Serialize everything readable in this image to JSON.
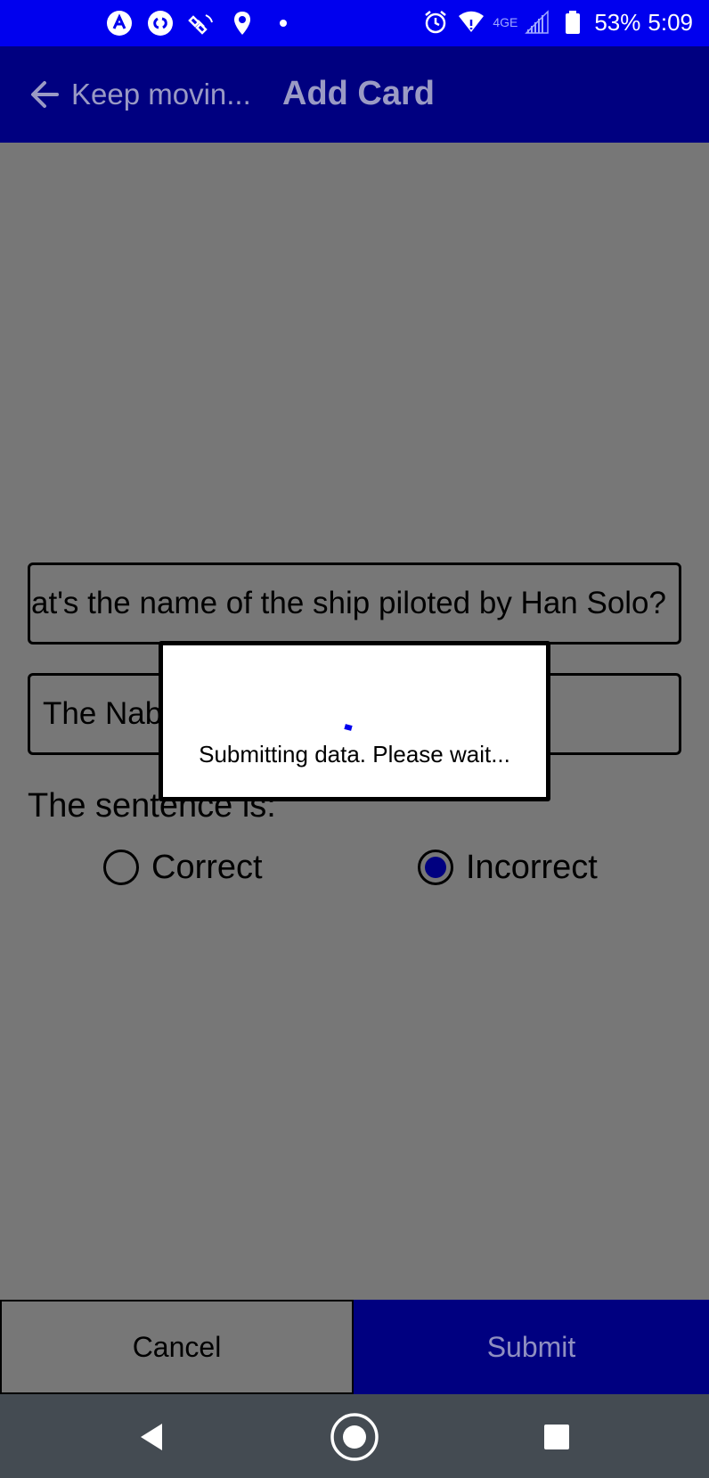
{
  "status_bar": {
    "left_icons": [
      "autodesk-icon",
      "shazam-icon",
      "satellite-icon",
      "location-pin-icon",
      "notification-dot-icon"
    ],
    "right_icons": [
      "alarm-icon",
      "wifi-icon",
      "signal-icon",
      "battery-icon"
    ],
    "network_label": "4GE",
    "battery": "53%",
    "time": "5:09",
    "color": "#0000ee"
  },
  "app_bar": {
    "back_label": "Keep movin...",
    "title": "Add Card",
    "color": "#000080"
  },
  "form": {
    "question_value": "What's the name of the ship piloted by Han Solo?",
    "answer_value": "The Nab",
    "sentence_label": "The sentence is:",
    "options": [
      {
        "label": "Correct",
        "selected": false
      },
      {
        "label": "Incorrect",
        "selected": true
      }
    ]
  },
  "buttons": {
    "cancel": "Cancel",
    "submit": "Submit"
  },
  "dialog": {
    "message": "Submitting data. Please wait..."
  },
  "nav_bar": {
    "buttons": [
      "back-icon",
      "home-icon",
      "recents-icon"
    ]
  }
}
